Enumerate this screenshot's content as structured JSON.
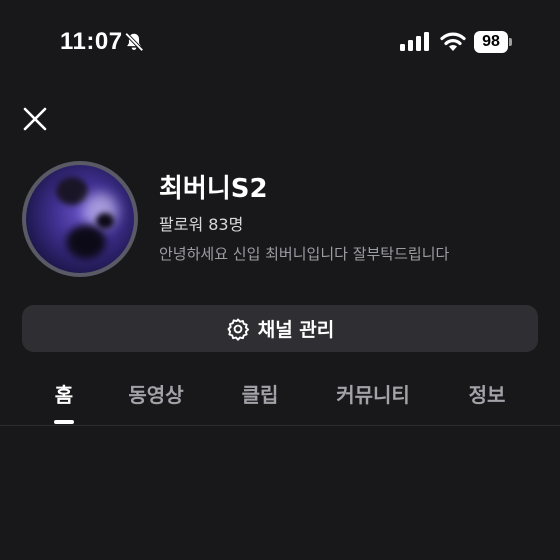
{
  "status_bar": {
    "time": "11:07",
    "battery": "98",
    "icons": [
      "bell-off-icon",
      "signal-icon",
      "wifi-icon",
      "battery-icon"
    ]
  },
  "header": {
    "close_icon": "close-icon"
  },
  "profile": {
    "channel_name": "최버니S2",
    "subscribers": "팔로워 83명",
    "description": "안녕하세요 신입 최버니입니다 잘부탁드립니다"
  },
  "manage_button": {
    "icon": "gear-icon",
    "label": "채널 관리"
  },
  "tabs": [
    {
      "label": "홈",
      "active": true
    },
    {
      "label": "동영상",
      "active": false
    },
    {
      "label": "클립",
      "active": false
    },
    {
      "label": "커뮤니티",
      "active": false
    },
    {
      "label": "정보",
      "active": false
    }
  ],
  "colors": {
    "background": "#18181b",
    "button_bg": "#2f2f33",
    "text_primary": "#ffffff",
    "text_secondary": "#9c9ca3",
    "tab_inactive": "#a2a2a8"
  }
}
